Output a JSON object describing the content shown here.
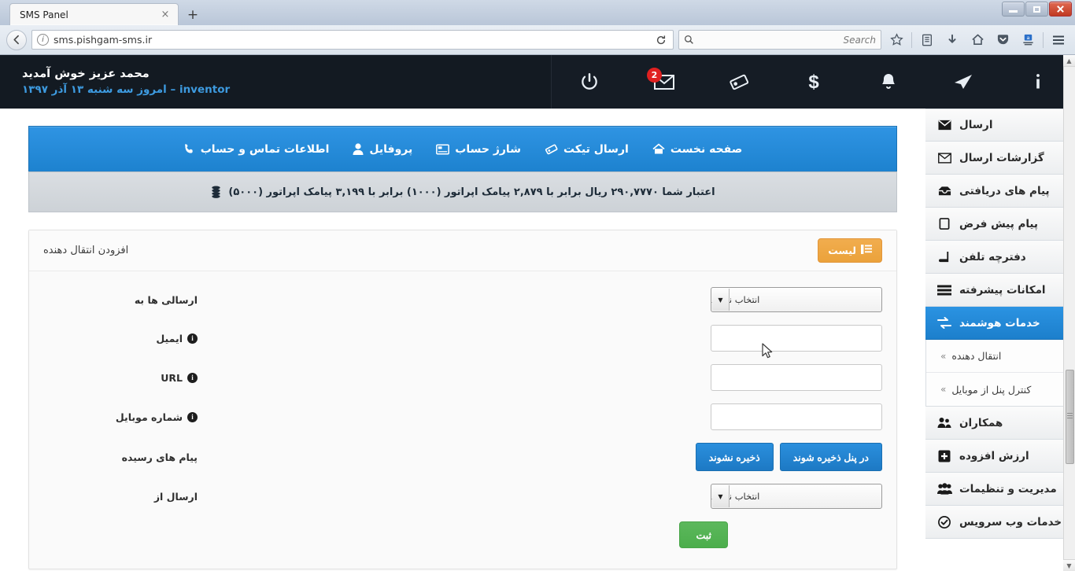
{
  "browser": {
    "tab_title": "SMS Panel",
    "tab_close": "×",
    "new_tab": "+",
    "url": "sms.pishgam-sms.ir",
    "search_placeholder": "Search",
    "reload_glyph": "⟳",
    "back_glyph": "←",
    "identity_glyph": "i",
    "window": {
      "minimize": "–",
      "restore": "□",
      "close": "✕"
    },
    "toolbar_icons": [
      "bookmark-star-icon",
      "library-icon",
      "downloads-icon",
      "home-icon",
      "pocket-icon",
      "account-icon",
      "hamburger-menu-icon"
    ]
  },
  "topbar": {
    "welcome_name": "محمد عزیز خوش آمدید",
    "welcome_sub": "inventor – امروز سه شنبه ۱۳ آذر ۱۳۹۷",
    "mail_badge": "2",
    "icons": [
      {
        "name": "power-icon"
      },
      {
        "name": "mail-icon"
      },
      {
        "name": "ticket-icon"
      },
      {
        "name": "dollar-icon"
      },
      {
        "name": "bell-icon"
      },
      {
        "name": "send-plane-icon"
      },
      {
        "name": "info-icon"
      }
    ]
  },
  "mainnav": {
    "items": [
      {
        "label": "صفحه نخست",
        "icon": "home-icon"
      },
      {
        "label": "ارسال تیکت",
        "icon": "ticket-icon"
      },
      {
        "label": "شارژ حساب",
        "icon": "credit-card-icon"
      },
      {
        "label": "پروفایل",
        "icon": "user-icon"
      },
      {
        "label": "اطلاعات تماس و حساب",
        "icon": "phone-icon"
      }
    ]
  },
  "credit": {
    "text": "اعتبار شما ۲۹۰,۷۷۷۰ ریال برابر با ۲,۸۷۹ پیامک اپراتور (۱۰۰۰) برابر با ۳,۱۹۹ پیامک اپراتور (۵۰۰۰)",
    "icon": "coins-icon"
  },
  "panel": {
    "title": "افزودن انتقال دهنده",
    "list_button": "لیست",
    "fields": {
      "sendto_label": "ارسالی ها به",
      "sendto_value": "انتخاب نمایید",
      "email_label": "ایمیل",
      "email_value": "",
      "url_label": "URL",
      "url_value": "",
      "mobile_label": "شماره موبایل",
      "mobile_value": "",
      "received_label": "پیام های رسیده",
      "received_btn_no": "ذخیره نشوند",
      "received_btn_yes": "در پنل ذخیره شوند",
      "sendfrom_label": "ارسال از",
      "sendfrom_value": "انتخاب نمایید",
      "info_glyph": "i"
    },
    "submit_button": "ثبت"
  },
  "sidebar": {
    "items": [
      {
        "label": "ارسال",
        "icon": "mail-filled-icon",
        "active": false
      },
      {
        "label": "گزارشات ارسال",
        "icon": "mail-outline-icon",
        "active": false
      },
      {
        "label": "پیام های دریافتی",
        "icon": "inbox-icon",
        "active": false
      },
      {
        "label": "پیام پیش فرض",
        "icon": "note-icon",
        "active": false
      },
      {
        "label": "دفترچه تلفن",
        "icon": "book-icon",
        "active": false
      },
      {
        "label": "امکانات پیشرفته",
        "icon": "layers-icon",
        "active": false
      },
      {
        "label": "خدمات هوشمند",
        "icon": "exchange-icon",
        "active": true
      }
    ],
    "submenu": [
      {
        "label": "انتقال دهنده",
        "chev": "»"
      },
      {
        "label": "کنترل پنل از موبایل",
        "chev": "»"
      }
    ],
    "items_after": [
      {
        "label": "همکاران",
        "icon": "partners-icon"
      },
      {
        "label": "ارزش افزوده",
        "icon": "plus-square-icon"
      },
      {
        "label": "مدیریت و تنظیمات",
        "icon": "users-icon"
      },
      {
        "label": "خدمات وب سرویس",
        "icon": "check-circle-icon"
      }
    ]
  },
  "colors": {
    "accent_blue": "#1d82cf",
    "dark_header": "#131a22",
    "orange": "#eba23b",
    "green": "#4cae4c",
    "badge_red": "#e02020"
  }
}
